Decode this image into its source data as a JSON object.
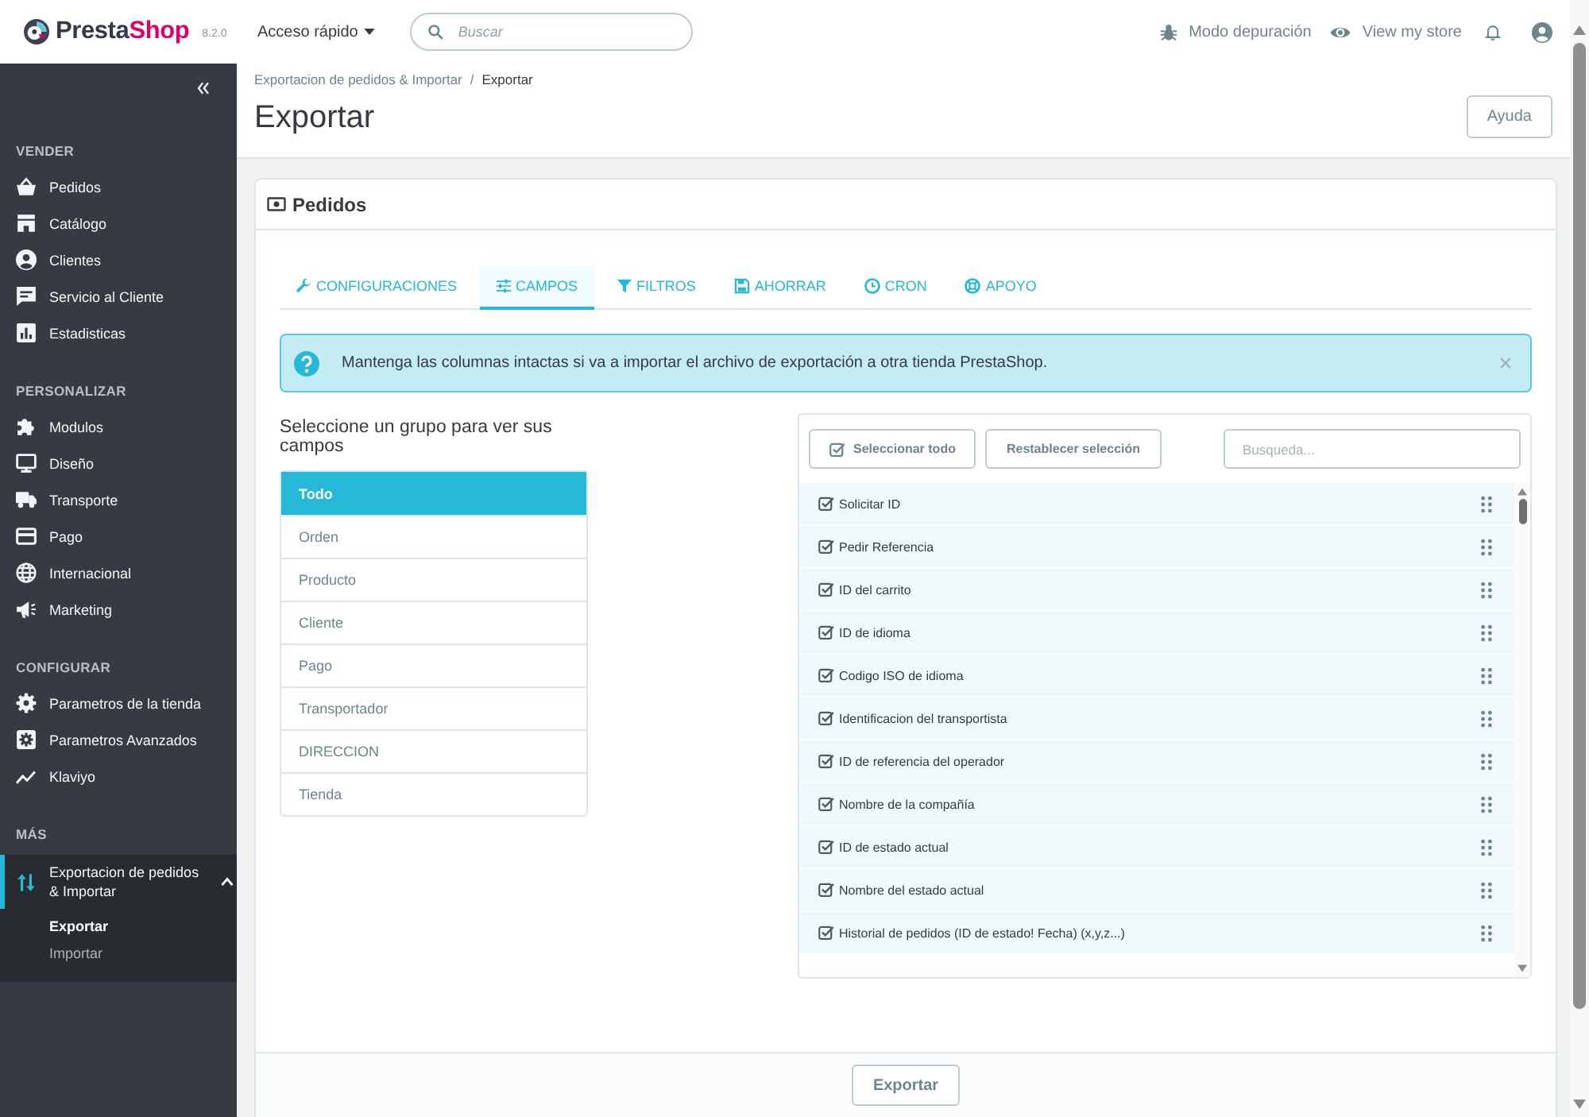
{
  "topbar": {
    "logo": {
      "parts": [
        "Presta",
        "Shop"
      ],
      "version": "8.2.0"
    },
    "quick_access": "Acceso rápido",
    "search": {
      "placeholder": "Buscar"
    },
    "debug_mode": "Modo depuración",
    "view_store": "View my store"
  },
  "sidebar": {
    "sections": [
      {
        "title": "VENDER",
        "items": [
          {
            "label": "Pedidos",
            "selected": false
          },
          {
            "label": "Catálogo",
            "selected": false
          },
          {
            "label": "Clientes",
            "selected": false
          },
          {
            "label": "Servicio al Cliente",
            "selected": false
          },
          {
            "label": "Estadisticas",
            "selected": false
          }
        ]
      },
      {
        "title": "PERSONALIZAR",
        "items": [
          {
            "label": "Modulos",
            "selected": false
          },
          {
            "label": "Diseño",
            "selected": false
          },
          {
            "label": "Transporte",
            "selected": false
          },
          {
            "label": "Pago",
            "selected": false
          },
          {
            "label": "Internacional",
            "selected": false
          },
          {
            "label": "Marketing",
            "selected": false
          }
        ]
      },
      {
        "title": "CONFIGURAR",
        "items": [
          {
            "label": "Parametros de la tienda",
            "selected": false
          },
          {
            "label": "Parametros Avanzados",
            "selected": false
          },
          {
            "label": "Klaviyo",
            "selected": false
          }
        ]
      },
      {
        "title": "MÁS",
        "items": [
          {
            "label": "Exportacion de pedidos & Importar",
            "selected": true,
            "expanded": true,
            "children": [
              {
                "label": "Exportar",
                "selected": true
              },
              {
                "label": "Importar",
                "selected": false
              }
            ]
          }
        ]
      }
    ]
  },
  "page_header": {
    "breadcrumb": {
      "items": [
        "Exportacion de pedidos & Importar",
        "Exportar"
      ],
      "separator": "/"
    },
    "title": "Exportar",
    "help_button": "Ayuda"
  },
  "card": {
    "title": "Pedidos",
    "tabs": [
      {
        "label": "CONFIGURACIONES",
        "selected": false
      },
      {
        "label": "CAMPOS",
        "selected": true
      },
      {
        "label": "FILTROS",
        "selected": false
      },
      {
        "label": "AHORRAR",
        "selected": false
      },
      {
        "label": "CRON",
        "selected": false
      },
      {
        "label": "APOYO",
        "selected": false
      }
    ],
    "alert": {
      "text": "Mantenga las columnas intactas si va a importar el archivo de exportación a otra tienda PrestaShop."
    },
    "groups": {
      "heading": "Seleccione un grupo para ver sus campos",
      "items": [
        {
          "label": "Todo",
          "selected": true
        },
        {
          "label": "Orden",
          "selected": false
        },
        {
          "label": "Producto",
          "selected": false
        },
        {
          "label": "Cliente",
          "selected": false
        },
        {
          "label": "Pago",
          "selected": false
        },
        {
          "label": "Transportador",
          "selected": false
        },
        {
          "label": "DIRECCION",
          "selected": false
        },
        {
          "label": "Tienda",
          "selected": false
        }
      ]
    },
    "fields_panel": {
      "buttons": [
        {
          "label": "Seleccionar todo",
          "kind": "select_all"
        },
        {
          "label": "Restablecer selección",
          "kind": "reset"
        }
      ],
      "search": {
        "placeholder": "Busqueda..."
      },
      "fields": [
        {
          "label": "Solicitar ID",
          "checked": true
        },
        {
          "label": "Pedir Referencia",
          "checked": true
        },
        {
          "label": "ID del carrito",
          "checked": true
        },
        {
          "label": "ID de idioma",
          "checked": true
        },
        {
          "label": "Codigo ISO de idioma",
          "checked": true
        },
        {
          "label": "Identificacion del transportista",
          "checked": true
        },
        {
          "label": "ID de referencia del operador",
          "checked": true
        },
        {
          "label": "Nombre de la compañía",
          "checked": true
        },
        {
          "label": "ID de estado actual",
          "checked": true
        },
        {
          "label": "Nombre del estado actual",
          "checked": true
        },
        {
          "label": "Historial de pedidos (ID de estado! Fecha) (x,y,z...)",
          "checked": true
        }
      ]
    },
    "footer_button": "Exportar"
  }
}
